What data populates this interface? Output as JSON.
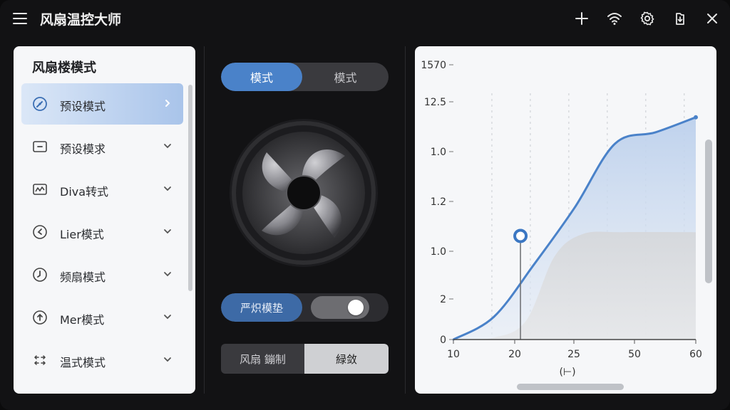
{
  "app": {
    "title": "风扇温控大师"
  },
  "toolbar": {
    "icons": [
      "menu-icon",
      "plus-icon",
      "wifi-icon",
      "gear-icon",
      "export-icon",
      "close-icon"
    ]
  },
  "sidebar": {
    "title": "风扇楼模式",
    "items": [
      {
        "label": "预设模式",
        "icon": "gauge-icon",
        "active": true
      },
      {
        "label": "预设模求",
        "icon": "minus-box-icon",
        "active": false
      },
      {
        "label": "Diva转式",
        "icon": "waveform-icon",
        "active": false
      },
      {
        "label": "Lier模式",
        "icon": "back-arrow-icon",
        "active": false
      },
      {
        "label": "频扇模式",
        "icon": "clock-icon",
        "active": false
      },
      {
        "label": "Mer模式",
        "icon": "up-arrow-icon",
        "active": false
      },
      {
        "label": "温式模式",
        "icon": "arrows-icon",
        "active": false
      }
    ]
  },
  "middle": {
    "segment": {
      "option_1": "模式",
      "option_2": "模式"
    },
    "toggle": {
      "label": "严炽模垫",
      "on": true
    },
    "bottom_segment": {
      "option_1": "风扇 鏰制",
      "option_2": "緑敛"
    }
  },
  "colors": {
    "accent": "#4a82c9",
    "panel_bg": "#f6f7f9",
    "window_bg": "#121214"
  },
  "chart_data": {
    "type": "area",
    "title": "",
    "xlabel": "(⊢)",
    "ylabel": "",
    "x_ticks": [
      "10",
      "20",
      "25",
      "50",
      "60"
    ],
    "y_ticks": [
      "0",
      "2",
      "1.0",
      "1.2",
      "1.0",
      "12.5",
      "1570"
    ],
    "series": [
      {
        "points": [
          [
            0,
            0
          ],
          [
            1,
            0.6
          ],
          [
            2,
            2.0
          ],
          [
            3,
            3.5
          ],
          [
            4,
            5.2
          ],
          [
            5,
            5.5
          ],
          [
            6,
            5.9
          ]
        ]
      },
      {
        "points": [
          [
            0,
            0
          ],
          [
            1,
            0.05
          ],
          [
            1.8,
            0.5
          ],
          [
            2.5,
            2.2
          ],
          [
            3.2,
            2.8
          ],
          [
            4.2,
            2.85
          ],
          [
            6,
            2.85
          ]
        ]
      }
    ],
    "marker": {
      "x": 1.66,
      "y": 2.75
    },
    "xlim": [
      0,
      6
    ],
    "ylim": [
      0,
      6.35
    ],
    "grid": "vertical-dashed"
  }
}
